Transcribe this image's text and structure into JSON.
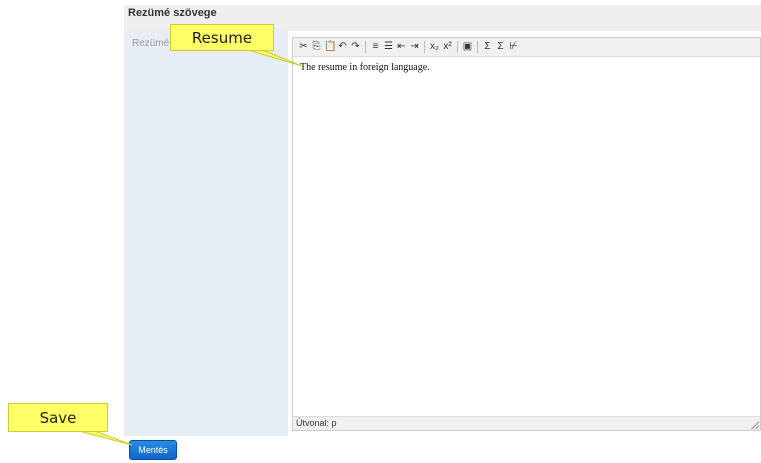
{
  "section": {
    "title": "Rezümé szövege"
  },
  "field": {
    "label": "Rezümé"
  },
  "editor": {
    "content": "The resume in foreign language.",
    "status_path": "Útvonal: p",
    "toolbar": [
      {
        "name": "cut-icon",
        "glyph": "✂"
      },
      {
        "name": "copy-icon",
        "glyph": "⎘"
      },
      {
        "name": "paste-icon",
        "glyph": "📋"
      },
      {
        "name": "undo-icon",
        "glyph": "↶"
      },
      {
        "name": "redo-icon",
        "glyph": "↷"
      },
      {
        "sep": true
      },
      {
        "name": "ordered-list-icon",
        "glyph": "≡"
      },
      {
        "name": "unordered-list-icon",
        "glyph": "☰"
      },
      {
        "name": "outdent-icon",
        "glyph": "⇤"
      },
      {
        "name": "indent-icon",
        "glyph": "⇥"
      },
      {
        "sep": true
      },
      {
        "name": "subscript-icon",
        "glyph": "x₂"
      },
      {
        "name": "superscript-icon",
        "glyph": "x²"
      },
      {
        "sep": true
      },
      {
        "name": "image-icon",
        "glyph": "▣"
      },
      {
        "sep": true
      },
      {
        "name": "sum-icon",
        "glyph": "Σ"
      },
      {
        "name": "sigma-icon",
        "glyph": "Σ"
      },
      {
        "name": "formula-icon",
        "glyph": "⊬"
      }
    ]
  },
  "buttons": {
    "save_label": "Mentés"
  },
  "callouts": {
    "resume": "Resume",
    "save": "Save"
  }
}
